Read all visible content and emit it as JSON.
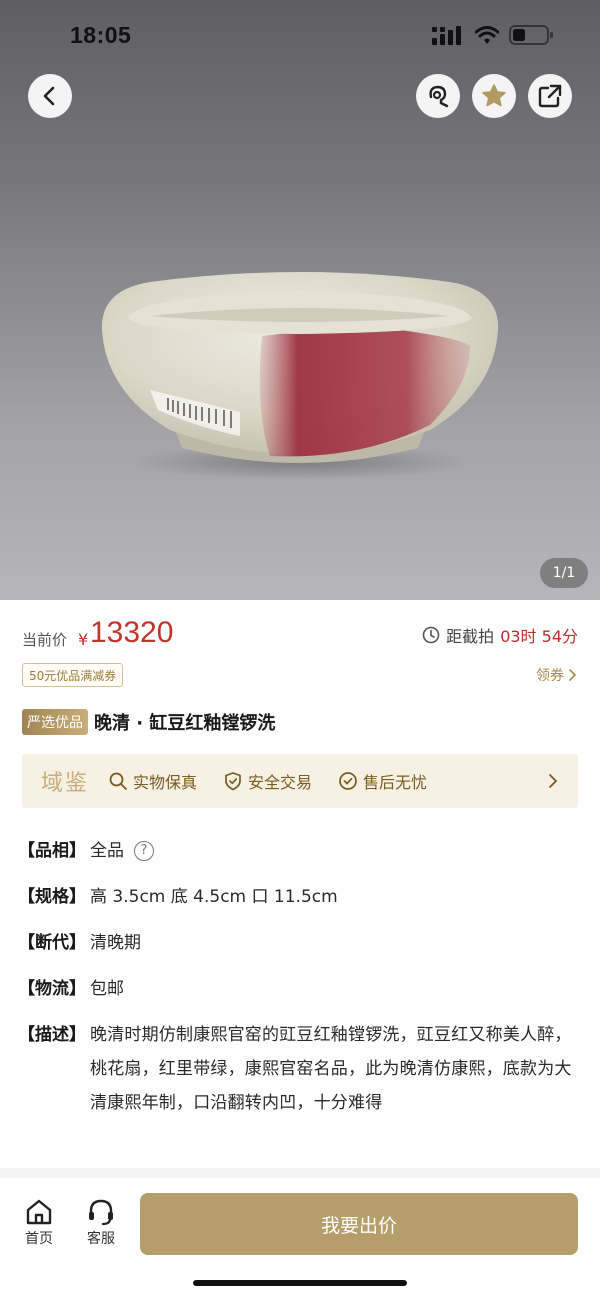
{
  "status_bar": {
    "time": "18:05"
  },
  "hero": {
    "page_counter": "1/1"
  },
  "price": {
    "label": "当前价",
    "currency": "¥",
    "value": "13320",
    "countdown_label": "距截拍",
    "countdown_value": "03时 54分"
  },
  "coupon": {
    "tag": "50元优品满减券",
    "get_label": "领券"
  },
  "item": {
    "badge": "严选优品",
    "title": "晚清 · 缸豆红釉镗锣洗"
  },
  "guarantee": {
    "brand": "域鉴",
    "items": [
      "实物保真",
      "安全交易",
      "售后无忧"
    ]
  },
  "attributes": [
    {
      "key": "【品相】",
      "value": "全品"
    },
    {
      "key": "【规格】",
      "value": "高 3.5cm 底 4.5cm 口 11.5cm"
    },
    {
      "key": "【断代】",
      "value": "清晚期"
    },
    {
      "key": "【物流】",
      "value": "包邮"
    },
    {
      "key": "【描述】",
      "value": "晚清时期仿制康熙官窑的豇豆红釉镗锣洗，豇豆红又称美人醉，桃花扇，红里带绿，康熙官窑名品，此为晚清仿康熙，底款为大清康熙年制，口沿翻转内凹，十分难得"
    }
  ],
  "bottom_bar": {
    "home_label": "首页",
    "service_label": "客服",
    "bid_label": "我要出价"
  },
  "colors": {
    "price_red": "#c0352b",
    "gold_accent": "#b59e6a",
    "guarantee_bg": "#f7f1e4"
  },
  "icons": [
    "back-icon",
    "customer-service-icon",
    "star-icon",
    "share-icon",
    "clock-icon",
    "search-icon",
    "shield-icon",
    "check-circle-icon",
    "chevron-right-icon",
    "home-icon",
    "headset-icon",
    "help-icon"
  ]
}
